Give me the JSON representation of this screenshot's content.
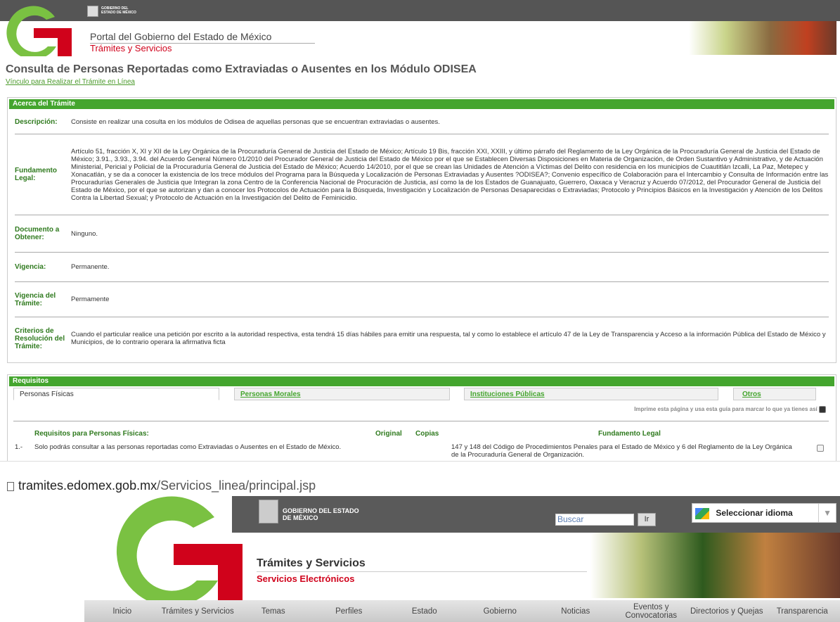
{
  "header": {
    "seal_text": "GOBIERNO DEL ESTADO DE MÉXICO",
    "portal": "Portal del Gobierno del Estado de México",
    "section": "Trámites y Servicios"
  },
  "page": {
    "title": "Consulta de Personas Reportadas como Extraviadas o Ausentes en los Módulo ODISEA",
    "online_link": "Vínculo para Realizar el Trámite en Línea"
  },
  "acerca": {
    "heading": "Acerca del Trámite",
    "rows": [
      {
        "label": "Descripción:",
        "value": "Consiste en realizar una cosulta en los módulos de Odisea de aquellas personas que se encuentran extraviadas o ausentes."
      },
      {
        "label": "Fundamento Legal:",
        "value": "Artículo 51, fracción X, XI y XII de la Ley Orgánica de la Procuraduría General de Justicia del Estado de México; Artículo 19 Bis, fracción XXI, XXIII, y último párrafo del Reglamento de la Ley Orgánica de la Procuraduría General de Justicia del Estado de México; 3.91., 3.93., 3.94. del Acuerdo General Número 01/2010 del Procurador General de Justicia del Estado de México por el que se Establecen Diversas Disposiciones en Materia de Organización, de Orden Sustantivo y Administrativo, y de Actuación Ministerial, Pericial y Policial de la Procuraduría General de Justicia del Estado de México; Acuerdo 14/2010, por el que se crean las Unidades de Atención a Víctimas del Delito con residencia en los municipios de Cuautitlán Izcalli, La Paz, Metepec y Xonacatlán, y se da a conocer la existencia de los trece módulos del Programa para la Búsqueda y Localización de Personas Extraviadas y Ausentes ?ODISEA?; Convenio específico de Colaboración para el Intercambio y Consulta de Información entre las Procuradurías Generales de Justicia que Integran la zona Centro de la Conferencia Nacional de Procuración de Justicia, así como la de los Estados de Guanajuato, Guerrero, Oaxaca y Veracruz y Acuerdo 07/2012, del Procurador General de Justicia del Estado de México, por el que se autorizan y dan a conocer los Protocolos de Actuación para la Búsqueda, Investigación y Localización de Personas Desaparecidas o Extraviadas; Protocolo y Principios Básicos en la Investigación y Atención de los Delitos Contra la Libertad Sexual; y Protocolo de Actuación en la Investigación del Delito de Feminicidio."
      },
      {
        "label": "Documento a Obtener:",
        "value": "Ninguno."
      },
      {
        "label": "Vigencia:",
        "value": "Permanente."
      },
      {
        "label": "Vigencia del Trámite:",
        "value": "Permamente"
      },
      {
        "label": "Criterios de Resolución del Trámite:",
        "value": "Cuando el particular realice una petición por escrito a la autoridad respectiva, esta tendrá 15 días hábiles para emitir una respuesta, tal y como lo establece el artículo 47 de la Ley de Transparencia y Acceso a la información Pública del Estado de México y Municipios, de lo contrario operara la afirmativa ficta"
      }
    ]
  },
  "requisitos": {
    "heading": "Requisitos",
    "tabs": [
      "Personas Físicas",
      "Personas Morales",
      "Instituciones Públicas",
      "Otros"
    ],
    "print_note": "Imprime esta página y usa esta guía para marcar lo que ya tienes así",
    "col_req": "Requisitos para Personas Físicas:",
    "col_orig": "Original",
    "col_cop": "Copias",
    "col_fund": "Fundamento Legal",
    "item_num": "1.-",
    "item_text": "Solo podrás consultar a las personas reportadas como Extraviadas o Ausentes en el Estado de México.",
    "item_fund": "147 y 148 del Código de Procedimientos Penales para el Estado de México y 6 del Reglamento de la Ley Orgánica de la Procuraduría General de Organización."
  },
  "url": {
    "domain": "tramites.edomex.gob.mx",
    "path": "/Servicios_linea/principal.jsp"
  },
  "site": {
    "seal_text": "GOBIERNO DEL ESTADO DE MÉXICO",
    "search_placeholder": "Buscar",
    "go": "Ir",
    "language": "Seleccionar idioma",
    "title": "Trámites y Servicios",
    "subtitle": "Servicios Electrónicos",
    "nav": [
      "Inicio",
      "Trámites y Servicios",
      "Temas",
      "Perfiles",
      "Estado",
      "Gobierno",
      "Noticias",
      "Eventos y Convocatorias",
      "Directorios y Quejas",
      "Transparencia"
    ]
  },
  "colors": {
    "green": "#44a52e",
    "red": "#d0021b"
  }
}
